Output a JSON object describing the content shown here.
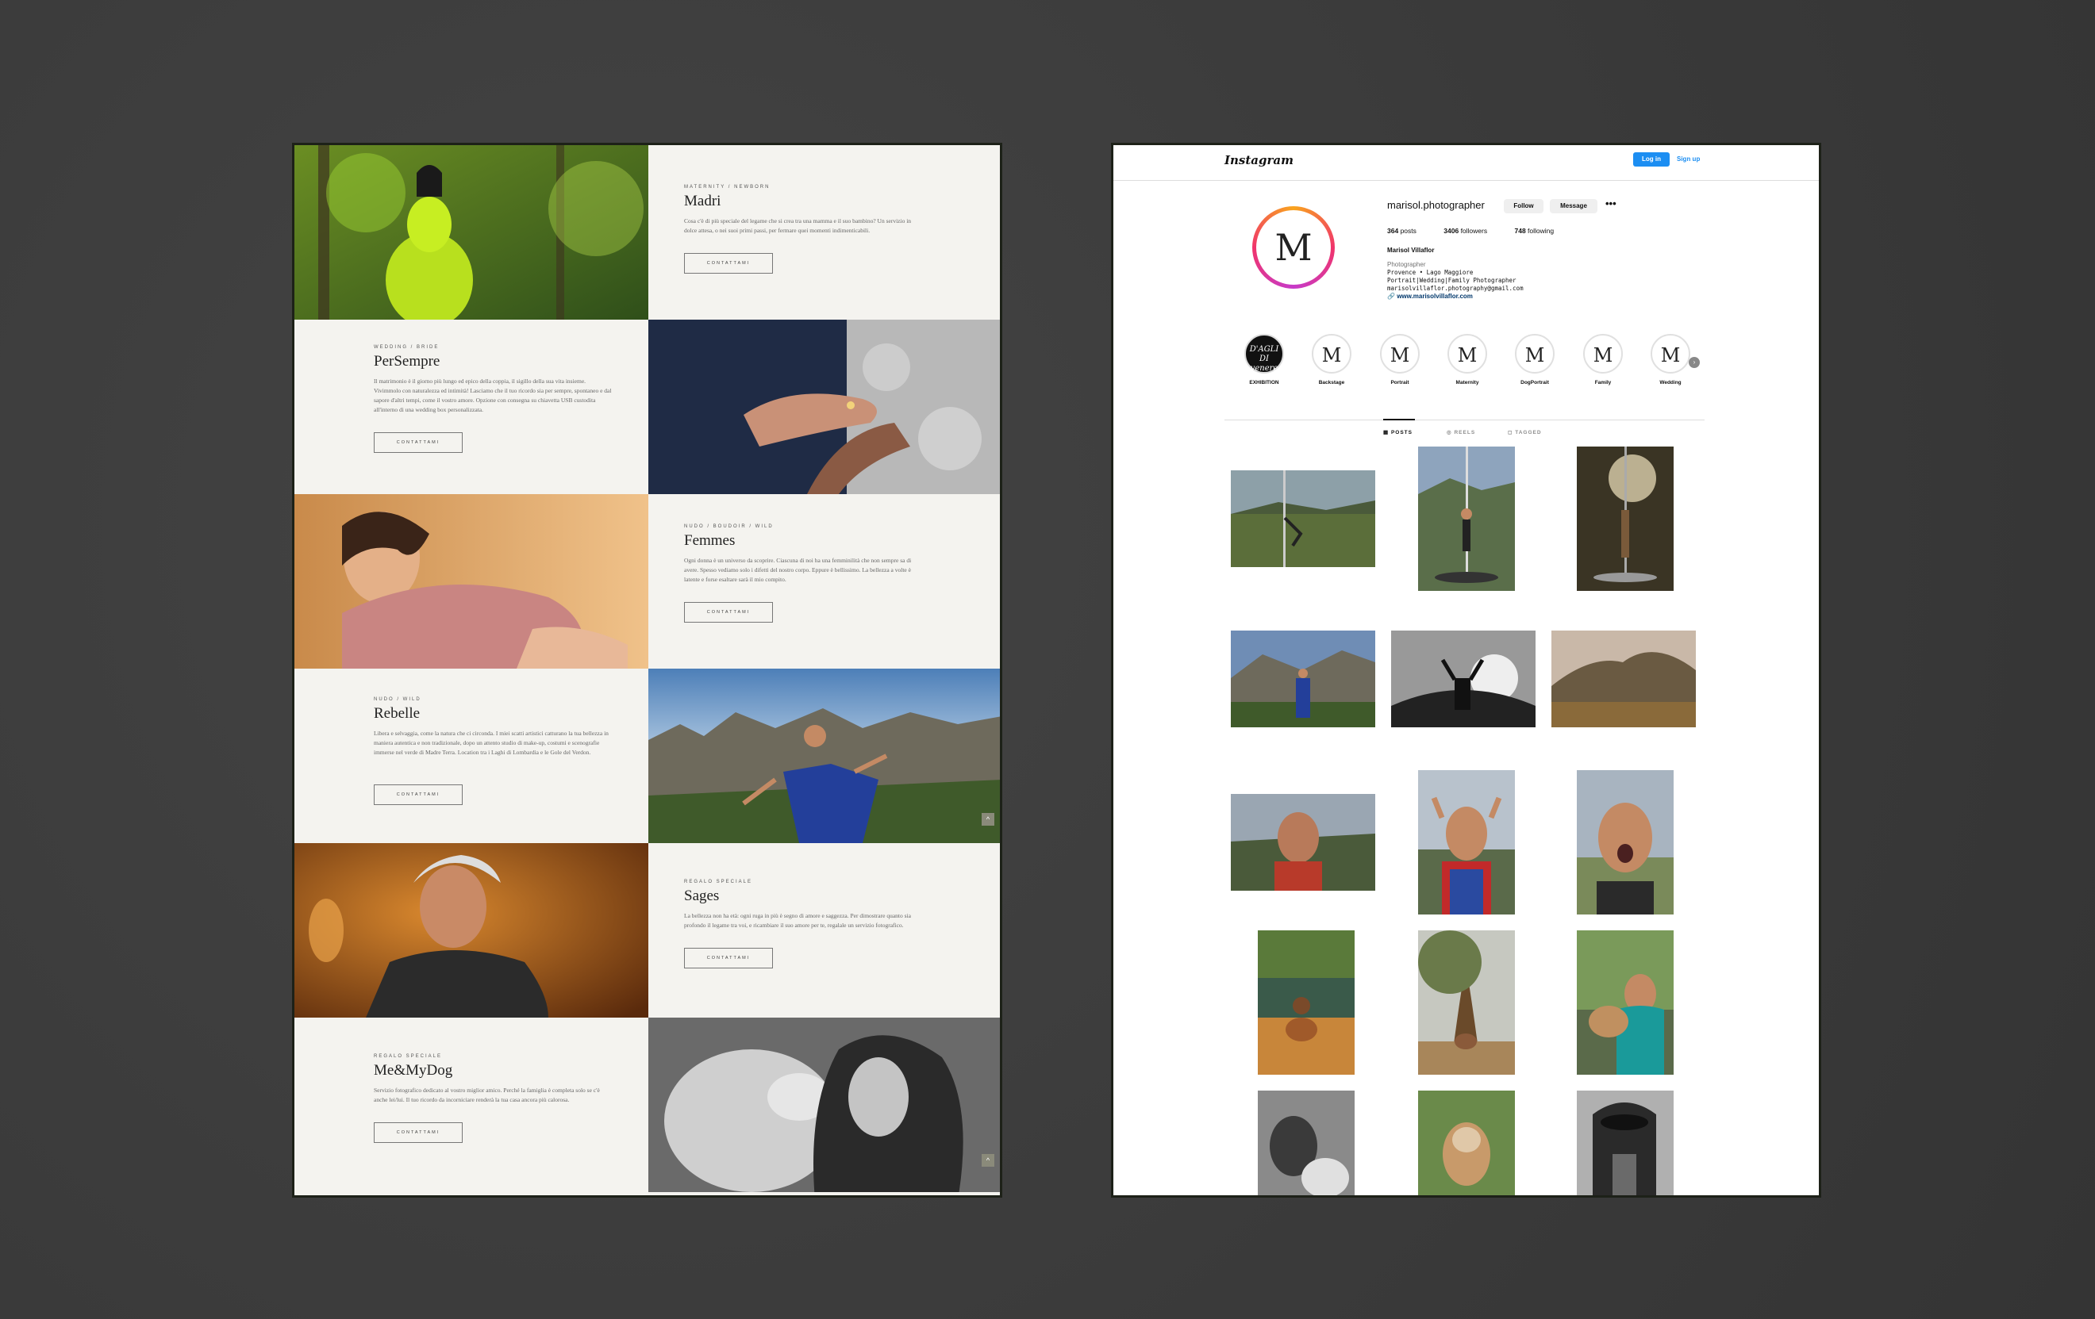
{
  "website": {
    "button_label": "CONTATTAMI",
    "sections": [
      {
        "tag": "MATERNITY / NEWBORN",
        "title": "Madri",
        "text": "Cosa c'è di più speciale del legame che si crea tra una mamma e il suo bambino? Un servizio in dolce attesa, o nei suoi primi passi, per fermare quei momenti indimenticabili."
      },
      {
        "tag": "WEDDING / BRIDE",
        "title": "PerSempre",
        "text": "Il matrimonio è il giorno più lungo ed epico della coppia, il sigillo della sua vita insieme. Vivimmolo con naturalezza ed intimità! Lasciamo che il tuo ricordo sia per sempre, spontaneo e dal sapore d'altri tempi, come il vostro amore. Opzione con consegna su chiavetta USB custodita all'interno di una wedding box personalizzata."
      },
      {
        "tag": "NUDO / BOUDOIR / WILD",
        "title": "Femmes",
        "text": "Ogni donna è un universo da scoprire. Ciascuna di noi ha una femminilità che non sempre sa di avere. Spesso vediamo solo i difetti del nostro corpo. Eppure è bellissimo. La bellezza a volte è latente e forse esaltare sarà il mio compito."
      },
      {
        "tag": "NUDO / WILD",
        "title": "Rebelle",
        "text": "Libera e selvaggia, come la natura che ci circonda. I miei scatti artistici catturano la tua bellezza in maniera autentica e non tradizionale, dopo un attento studio di make-up, costumi e scenografie immerse nel verde di Madre Terra. Location tra i Laghi di Lombardia e le Gole del Verdon."
      },
      {
        "tag": "REGALO SPECIALE",
        "title": "Sages",
        "text": "La bellezza non ha età: ogni ruga in più è segno di amore e saggezza. Per dimostrare quanto sia profondo il legame tra voi, e ricambiare il suo amore per te, regalale un servizio fotografico."
      },
      {
        "tag": "REGALO SPECIALE",
        "title": "Me&MyDog",
        "text": "Servizio fotografico dedicato al vostro miglior amico. Perché la famiglia è completa solo se c'è anche lei/lui. Il tuo ricordo da incorniciare renderà la tua casa ancora più calorosa."
      }
    ]
  },
  "instagram": {
    "logo": "Instagram",
    "login_label": "Log in",
    "signup_label": "Sign up",
    "username": "marisol.photographer",
    "follow_label": "Follow",
    "message_label": "Message",
    "more_label": "•••",
    "avatar_letter": "M",
    "stats": {
      "posts": "364",
      "posts_label": "posts",
      "followers": "3406",
      "followers_label": "followers",
      "following": "748",
      "following_label": "following"
    },
    "full_name": "Marisol Villaflor",
    "bio": {
      "category": "Photographer",
      "line1": "Provence • Lago Maggiore",
      "line2": "Portrait|Wedding|Family Photographer",
      "line3": "marisolvillaflor.photography@gmail.com",
      "link": "www.marisolvillaflor.com"
    },
    "highlights": [
      {
        "label": "EXHIBITION",
        "icon": "D'AGLI DI venere"
      },
      {
        "label": "Backstage",
        "icon": "M"
      },
      {
        "label": "Portrait",
        "icon": "M"
      },
      {
        "label": "Maternity",
        "icon": "M"
      },
      {
        "label": "DogPortrait",
        "icon": "M"
      },
      {
        "label": "Family",
        "icon": "M"
      },
      {
        "label": "Wedding",
        "icon": "M"
      }
    ],
    "tabs": {
      "posts": "POSTS",
      "reels": "REELS",
      "tagged": "TAGGED"
    }
  }
}
